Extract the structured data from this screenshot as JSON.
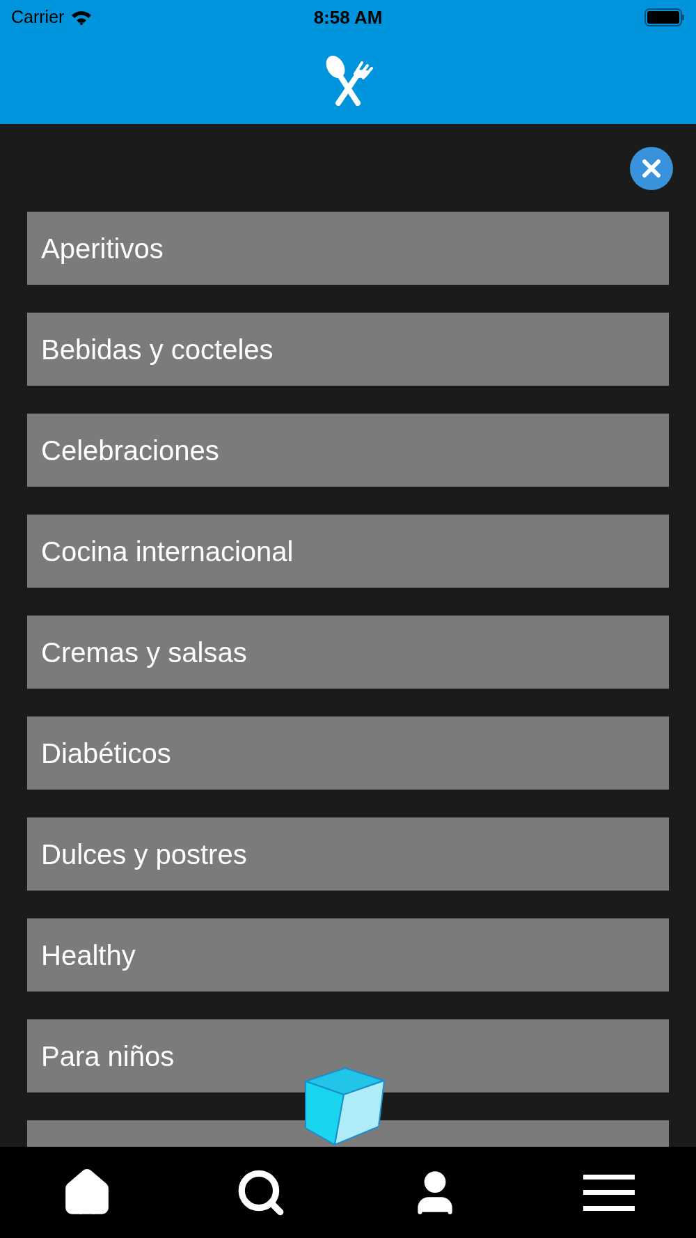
{
  "status_bar": {
    "carrier": "Carrier",
    "time": "8:58 AM"
  },
  "categories": [
    {
      "label": "Aperitivos"
    },
    {
      "label": "Bebidas y cocteles"
    },
    {
      "label": "Celebraciones"
    },
    {
      "label": "Cocina internacional"
    },
    {
      "label": "Cremas y salsas"
    },
    {
      "label": "Diabéticos"
    },
    {
      "label": "Dulces y postres"
    },
    {
      "label": "Healthy"
    },
    {
      "label": "Para niños"
    },
    {
      "cut_off": true
    }
  ]
}
